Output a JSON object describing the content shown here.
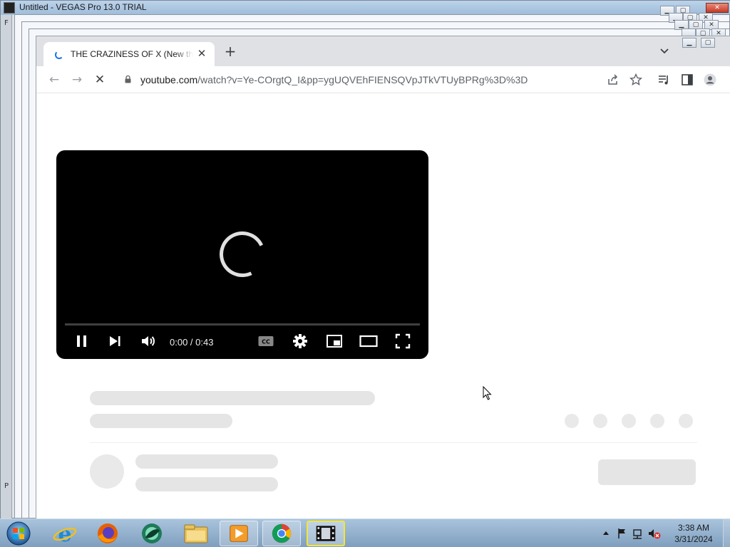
{
  "vegas": {
    "title": "Untitled - VEGAS Pro 13.0 TRIAL",
    "side_letters": [
      "F",
      "P"
    ]
  },
  "browser": {
    "tab": {
      "title": "THE CRAZINESS OF X (New things added",
      "close_glyph": "✕"
    },
    "new_tab_glyph": "+",
    "back_glyph": "←",
    "forward_glyph": "→",
    "reload_glyph": "✕",
    "url_host": "youtube.com",
    "url_path": "/watch?v=Ye-COrgtQ_I&pp=ygUQVEhFIENSQVpJTkVTUyBPRg%3D%3D"
  },
  "player": {
    "time": "0:00 / 0:43",
    "progress": 0
  },
  "taskbar": {
    "apps": [
      "internet-explorer",
      "firefox",
      "vpn-client",
      "file-explorer",
      "media-player",
      "chrome",
      "vegas-pro"
    ],
    "clock_time": "3:38 AM",
    "clock_date": "3/31/2024"
  }
}
